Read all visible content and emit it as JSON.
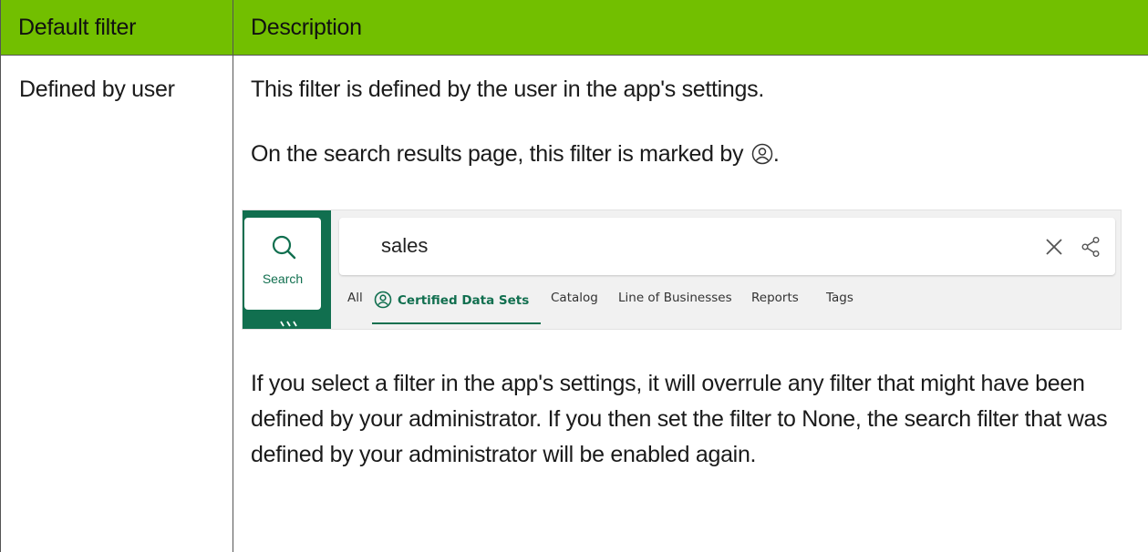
{
  "table": {
    "headers": [
      "Default filter",
      "Description"
    ],
    "row": {
      "filter": "Defined by user",
      "description_p1": "This filter is defined by the user in the app's settings.",
      "description_p2": "On the search results page, this filter is marked by",
      "description_p2_end": ".",
      "description_p3": "If you select a filter in the app's settings, it will overrule any filter that might have been defined by your administrator. If you then set the filter to None, the search filter that was defined by your administrator will be enabled again."
    }
  },
  "screenshot": {
    "rail_label": "Search",
    "search_value": "sales",
    "tabs": [
      "All",
      "Certified Data Sets",
      "Catalog",
      "Line of Businesses",
      "Reports",
      "Tags"
    ]
  },
  "colors": {
    "header_bg": "#72bf00",
    "brand_green": "#116f4f"
  },
  "icons": [
    "user-circle-icon",
    "search-icon",
    "close-icon",
    "share-icon"
  ]
}
